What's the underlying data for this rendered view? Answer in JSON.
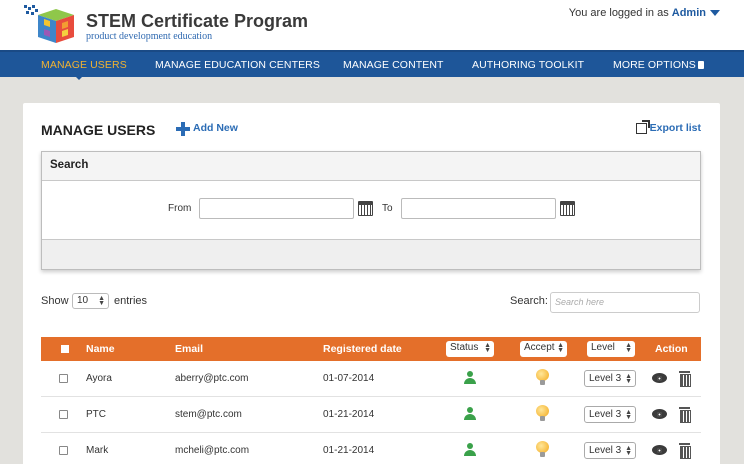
{
  "header": {
    "title": "STEM Certificate Program",
    "subtitle": "product development education",
    "login_prefix": "You are logged in as",
    "user": "Admin"
  },
  "nav": {
    "items": [
      "MANAGE USERS",
      "MANAGE EDUCATION CENTERS",
      "MANAGE CONTENT",
      "AUTHORING TOOLKIT",
      "MORE OPTIONS"
    ],
    "active": "MANAGE USERS"
  },
  "page": {
    "title": "MANAGE USERS",
    "add_new": "Add New",
    "export": "Export list"
  },
  "search_panel": {
    "title": "Search",
    "from_label": "From",
    "to_label": "To",
    "from_value": "",
    "to_value": ""
  },
  "list_controls": {
    "show_label": "Show",
    "entries_value": "10",
    "entries_label": "entries",
    "search_label": "Search:",
    "search_placeholder": "Search here"
  },
  "table": {
    "columns": [
      "Name",
      "Email",
      "Registered date",
      "Status",
      "Accept",
      "Level",
      "Action"
    ],
    "rows": [
      {
        "name": "Ayora",
        "email": "aberry@ptc.com",
        "date": "01-07-2014",
        "level": "Level 3"
      },
      {
        "name": "PTC",
        "email": "stem@ptc.com",
        "date": "01-21-2014",
        "level": "Level 3"
      },
      {
        "name": "Mark",
        "email": "mcheli@ptc.com",
        "date": "01-21-2014",
        "level": "Level 3"
      }
    ]
  },
  "colors": {
    "nav_bg": "#1e5699",
    "nav_active": "#f2b331",
    "table_header": "#e46f2a",
    "link": "#2b6cb5",
    "status_green": "#3aa14a"
  }
}
